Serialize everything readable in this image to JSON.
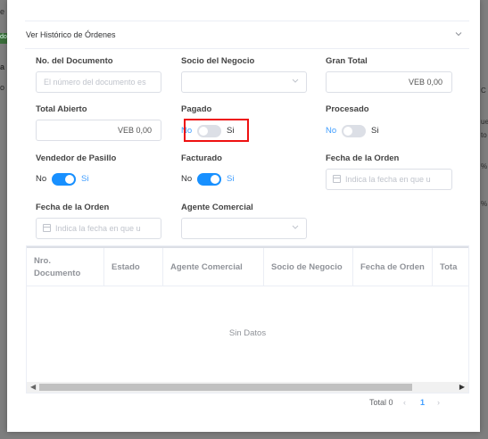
{
  "background": {
    "left_fragments": [
      "e",
      "do",
      "a",
      "o"
    ],
    "right_fragments": [
      "C",
      "ue",
      "to",
      "%",
      "%"
    ]
  },
  "section": {
    "title": "Ver Histórico de Órdenes"
  },
  "fields": {
    "documento": {
      "label": "No. del Documento",
      "placeholder": "El número del documento es"
    },
    "socio": {
      "label": "Socio del Negocio",
      "value": ""
    },
    "gran_total": {
      "label": "Gran Total",
      "value": "VEB 0,00"
    },
    "total_abierto": {
      "label": "Total Abierto",
      "value": "VEB 0,00"
    },
    "pagado": {
      "label": "Pagado",
      "no": "No",
      "si": "Si",
      "checked": false
    },
    "procesado": {
      "label": "Procesado",
      "no": "No",
      "si": "Si",
      "checked": false
    },
    "vendedor_pasillo": {
      "label": "Vendedor de Pasillo",
      "no": "No",
      "si": "Si",
      "checked": true
    },
    "facturado": {
      "label": "Facturado",
      "no": "No",
      "si": "Si",
      "checked": true
    },
    "fecha_orden_1": {
      "label": "Fecha de la Orden",
      "placeholder": "Indica la fecha en que u"
    },
    "fecha_orden_2": {
      "label": "Fecha de la Orden",
      "placeholder": "Indica la fecha en que u"
    },
    "agente": {
      "label": "Agente Comercial",
      "value": ""
    }
  },
  "table": {
    "columns": [
      "Nro. Documento",
      "Estado",
      "Agente Comercial",
      "Socio de Negocio",
      "Fecha de Orden",
      "Tota"
    ],
    "empty_text": "Sin Datos"
  },
  "pagination": {
    "total_label": "Total 0",
    "current_page": "1"
  },
  "colors": {
    "accent": "#409eff",
    "switch_on": "#1890ff",
    "switch_off": "#dcdfe6",
    "highlight": "#ee1111"
  }
}
